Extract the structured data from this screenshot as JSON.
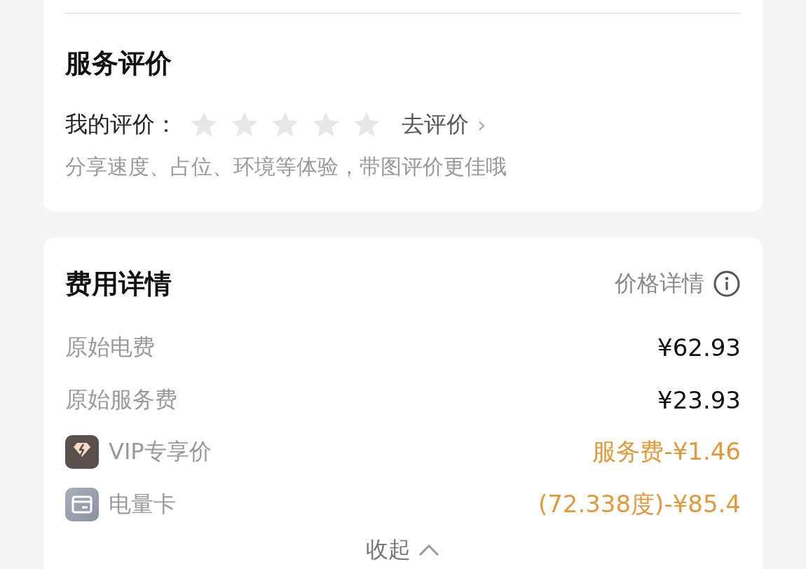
{
  "review": {
    "title": "服务评价",
    "my_label": "我的评价：",
    "stars": 0,
    "action": "去评价",
    "action_arrow": "›",
    "hint": "分享速度、占位、环境等体验，带图评价更佳哦"
  },
  "fees": {
    "title": "费用详情",
    "price_detail": "价格详情",
    "rows": [
      {
        "kind": "plain",
        "label": "原始电费",
        "value": "¥62.93"
      },
      {
        "kind": "plain",
        "label": "原始服务费",
        "value": "¥23.93"
      },
      {
        "kind": "vip",
        "label": "VIP专享价",
        "value": "服务费-¥1.46"
      },
      {
        "kind": "card",
        "label": "电量卡",
        "value": "(72.338度)-¥85.4"
      }
    ],
    "collapse": "收起"
  }
}
